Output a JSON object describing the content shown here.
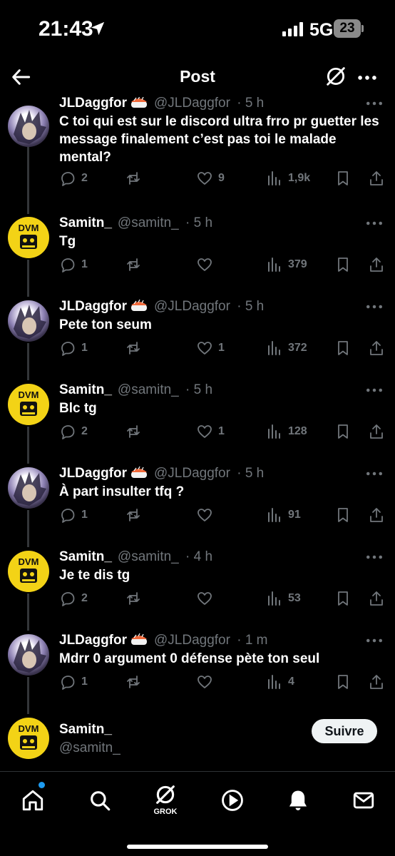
{
  "status_bar": {
    "time": "21:43",
    "network": "5G",
    "battery": "23",
    "icons": [
      "location-arrow-icon",
      "signal-bars-icon",
      "battery-icon"
    ]
  },
  "header": {
    "title": "Post",
    "icons": [
      "back-arrow-icon",
      "grok-icon",
      "more-icon"
    ]
  },
  "thread": {
    "tweets": [
      {
        "author": "JLDaggfor",
        "emoji": "sushi",
        "handle": "@JLDaggfor",
        "time": "· 5 h",
        "text": "C toi qui est sur le discord ultra frro pr guetter les message finalement c’est pas toi le malade mental?",
        "replies": "2",
        "retweets": "",
        "likes": "9",
        "views": "1,9k"
      },
      {
        "author": "Samitn_",
        "emoji": "",
        "handle": "@samitn_",
        "time": "· 5 h",
        "text": "Tg",
        "replies": "1",
        "retweets": "",
        "likes": "",
        "views": "379"
      },
      {
        "author": "JLDaggfor",
        "emoji": "sushi",
        "handle": "@JLDaggfor",
        "time": "· 5 h",
        "text": "Pete ton seum",
        "replies": "1",
        "retweets": "",
        "likes": "1",
        "views": "372"
      },
      {
        "author": "Samitn_",
        "emoji": "",
        "handle": "@samitn_",
        "time": "· 5 h",
        "text": "Blc tg",
        "replies": "2",
        "retweets": "",
        "likes": "1",
        "views": "128"
      },
      {
        "author": "JLDaggfor",
        "emoji": "sushi",
        "handle": "@JLDaggfor",
        "time": "· 5 h",
        "text": "À part insulter tfq ?",
        "replies": "1",
        "retweets": "",
        "likes": "",
        "views": "91"
      },
      {
        "author": "Samitn_",
        "emoji": "",
        "handle": "@samitn_",
        "time": "· 4 h",
        "text": "Je te dis tg",
        "replies": "2",
        "retweets": "",
        "likes": "",
        "views": "53"
      },
      {
        "author": "JLDaggfor",
        "emoji": "sushi",
        "handle": "@JLDaggfor",
        "time": "· 1 m",
        "text": "Mdrr 0 argument 0 défense pète ton seul",
        "replies": "1",
        "retweets": "",
        "likes": "",
        "views": "4"
      }
    ],
    "reply_author": {
      "name": "Samitn_",
      "handle": "@samitn_",
      "follow_label": "Suivre"
    }
  },
  "bottom_nav": {
    "items": [
      "home-icon",
      "search-icon",
      "grok-icon",
      "play-icon",
      "bell-icon",
      "mail-icon"
    ],
    "grok_label": "GROK",
    "home_has_notification_dot": true
  },
  "colors": {
    "background": "#000000",
    "text": "#e7e9ea",
    "muted": "#71767b",
    "accent": "#1d9bf0",
    "thread_line": "#333639"
  }
}
